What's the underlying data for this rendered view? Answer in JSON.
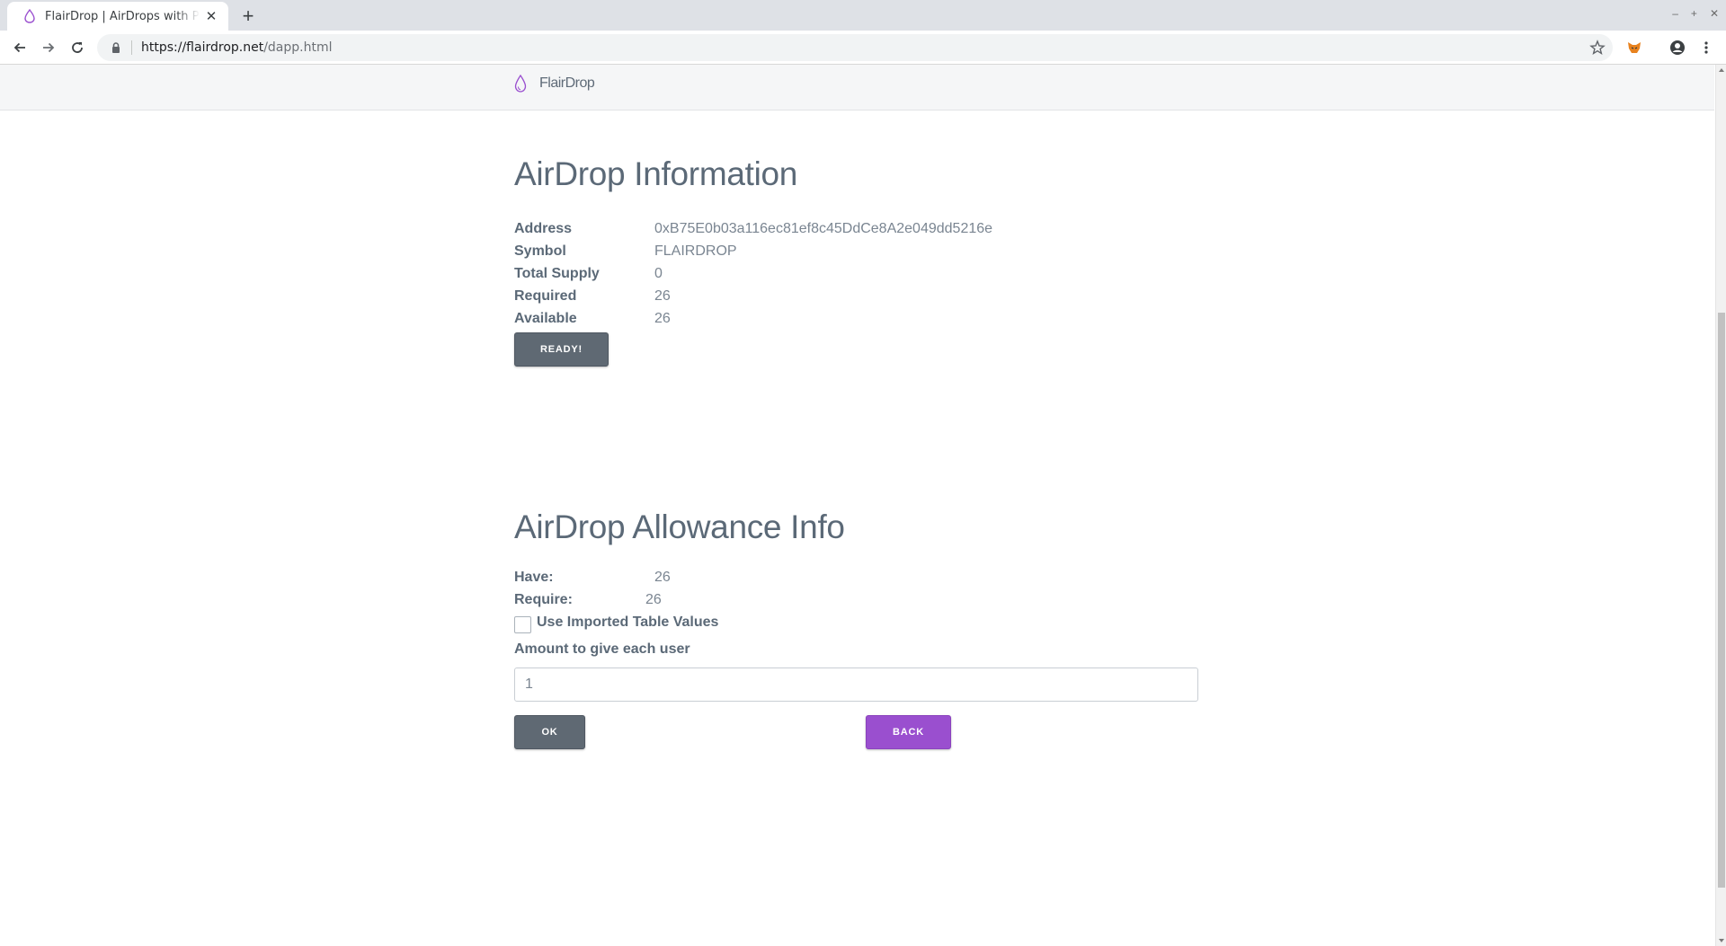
{
  "browser": {
    "tab_title": "FlairDrop | AirDrops with Pizzazz",
    "new_tab_symbol": "+",
    "url_host": "https://flairdrop.net",
    "url_path": "/dapp.html",
    "window_controls": [
      "–",
      "+",
      "✕"
    ]
  },
  "site": {
    "brand_name": "FlairDrop",
    "brand_color": "#9a4fcf"
  },
  "airdrop_information": {
    "title": "AirDrop Information",
    "rows": [
      {
        "label": "Address",
        "value": "0xB75E0b03a116ec81ef8c45DdCe8A2e049dd5216e"
      },
      {
        "label": "Symbol",
        "value": "FLAIRDROP"
      },
      {
        "label": "Total Supply",
        "value": "0"
      },
      {
        "label": "Required",
        "value": "26"
      },
      {
        "label": "Available",
        "value": "26"
      }
    ],
    "ready_button": "READY!"
  },
  "allowance_info": {
    "title": "AirDrop Allowance Info",
    "have_label": "Have:",
    "have_value": "26",
    "require_label": "Require:",
    "require_value": "26",
    "checkbox_label": "Use Imported Table Values",
    "checkbox_checked": false,
    "amount_label": "Amount to give each user",
    "amount_value": "1",
    "ok_button": "OK",
    "back_button": "BACK"
  }
}
